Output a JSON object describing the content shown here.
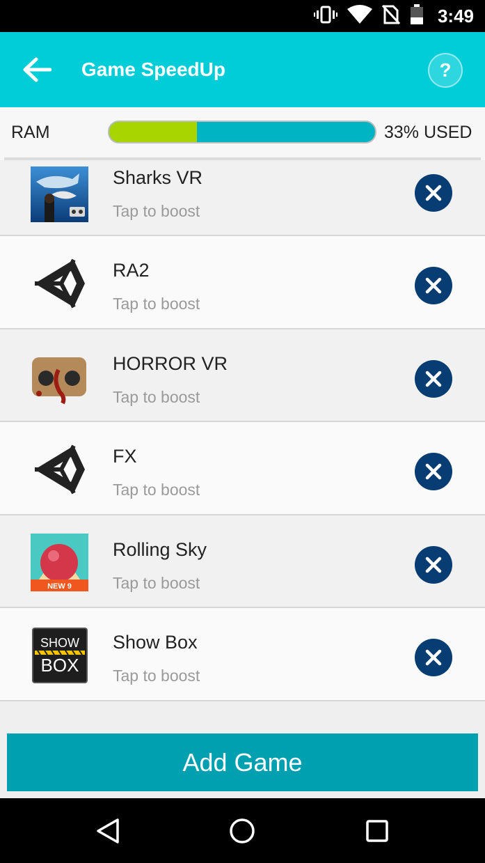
{
  "status_bar": {
    "time": "3:49",
    "icons": [
      "vibrate-icon",
      "wifi-icon",
      "no-sim-icon",
      "battery-icon"
    ]
  },
  "app_bar": {
    "title": "Game SpeedUp",
    "help_label": "?"
  },
  "ram": {
    "label": "RAM",
    "used_fraction": 0.33,
    "used_text": "33% USED",
    "colors": {
      "used": "#a8d400",
      "free": "#00b4c4"
    }
  },
  "games": [
    {
      "name": "Sharks VR",
      "subtitle": "Tap to boost",
      "icon": "sharks-vr-icon"
    },
    {
      "name": "RA2",
      "subtitle": "Tap to boost",
      "icon": "unity-icon"
    },
    {
      "name": "HORROR VR",
      "subtitle": "Tap to boost",
      "icon": "horror-vr-icon"
    },
    {
      "name": "FX",
      "subtitle": "Tap to boost",
      "icon": "unity-icon"
    },
    {
      "name": "Rolling Sky",
      "subtitle": "Tap to boost",
      "icon": "rolling-sky-icon",
      "badge": "NEW 9"
    },
    {
      "name": "Show Box",
      "subtitle": "Tap to boost",
      "icon": "show-box-icon",
      "logo_lines": [
        "SHOW",
        "BOX"
      ]
    }
  ],
  "add_button": {
    "label": "Add Game"
  },
  "theme": {
    "accent": "#00cdd8",
    "remove_button": "#083d74",
    "add_button": "#00a0b0"
  }
}
